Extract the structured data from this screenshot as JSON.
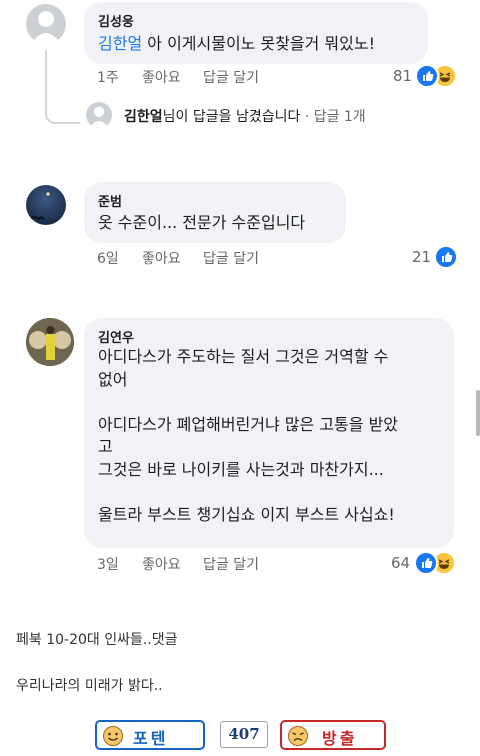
{
  "comments": [
    {
      "author": "김성웅",
      "mention": "김한얼",
      "text": " 아 이게시물이노 못찾을거 뭐있노!",
      "time": "1주",
      "like_label": "좋아요",
      "reply_label": "답글 달기",
      "reaction_count": "81",
      "reactions": [
        "like",
        "haha"
      ]
    },
    {
      "author": "준범",
      "text": "옷 수준이... 전문가 수준입니다",
      "time": "6일",
      "like_label": "좋아요",
      "reply_label": "답글 달기",
      "reaction_count": "21",
      "reactions": [
        "like"
      ]
    },
    {
      "author": "김연우",
      "text_lines": [
        "아디다스가 주도하는 질서 그것은 거역할 수",
        "없어",
        "",
        "아디다스가 폐업해버린거냐 많은 고통을 받았",
        "고",
        "그것은 바로 나이키를 사는것과 마찬가지...",
        "",
        "울트라 부스트 챙기십쇼 이지 부스트 사십쇼!"
      ],
      "time": "3일",
      "like_label": "좋아요",
      "reply_label": "답글 달기",
      "reaction_count": "64",
      "reactions": [
        "like",
        "haha"
      ]
    }
  ],
  "reply_summary": {
    "name": "김한얼",
    "text": "님이 답글을 남겼습니다",
    "count": " · 답글 1개"
  },
  "post_text": {
    "line1": "페북 10-20대 인싸들..댓글",
    "line2": "우리나라의 미래가 밝다.."
  },
  "vote_bar": {
    "up_label": "포텐",
    "count": "407",
    "down_label": "방출",
    "up_color": "#1565c0",
    "down_color": "#c62828",
    "face_color": "#f6c86a"
  },
  "colors": {
    "bubble": "#f0f2f5",
    "link": "#1877f2",
    "meta": "#65676b",
    "like": "#1877f2",
    "haha": "#f7c43b"
  },
  "icons": {
    "like": "thumbs-up-icon",
    "haha": "laughing-face-icon",
    "vote_face": "emoji-face-icon"
  }
}
